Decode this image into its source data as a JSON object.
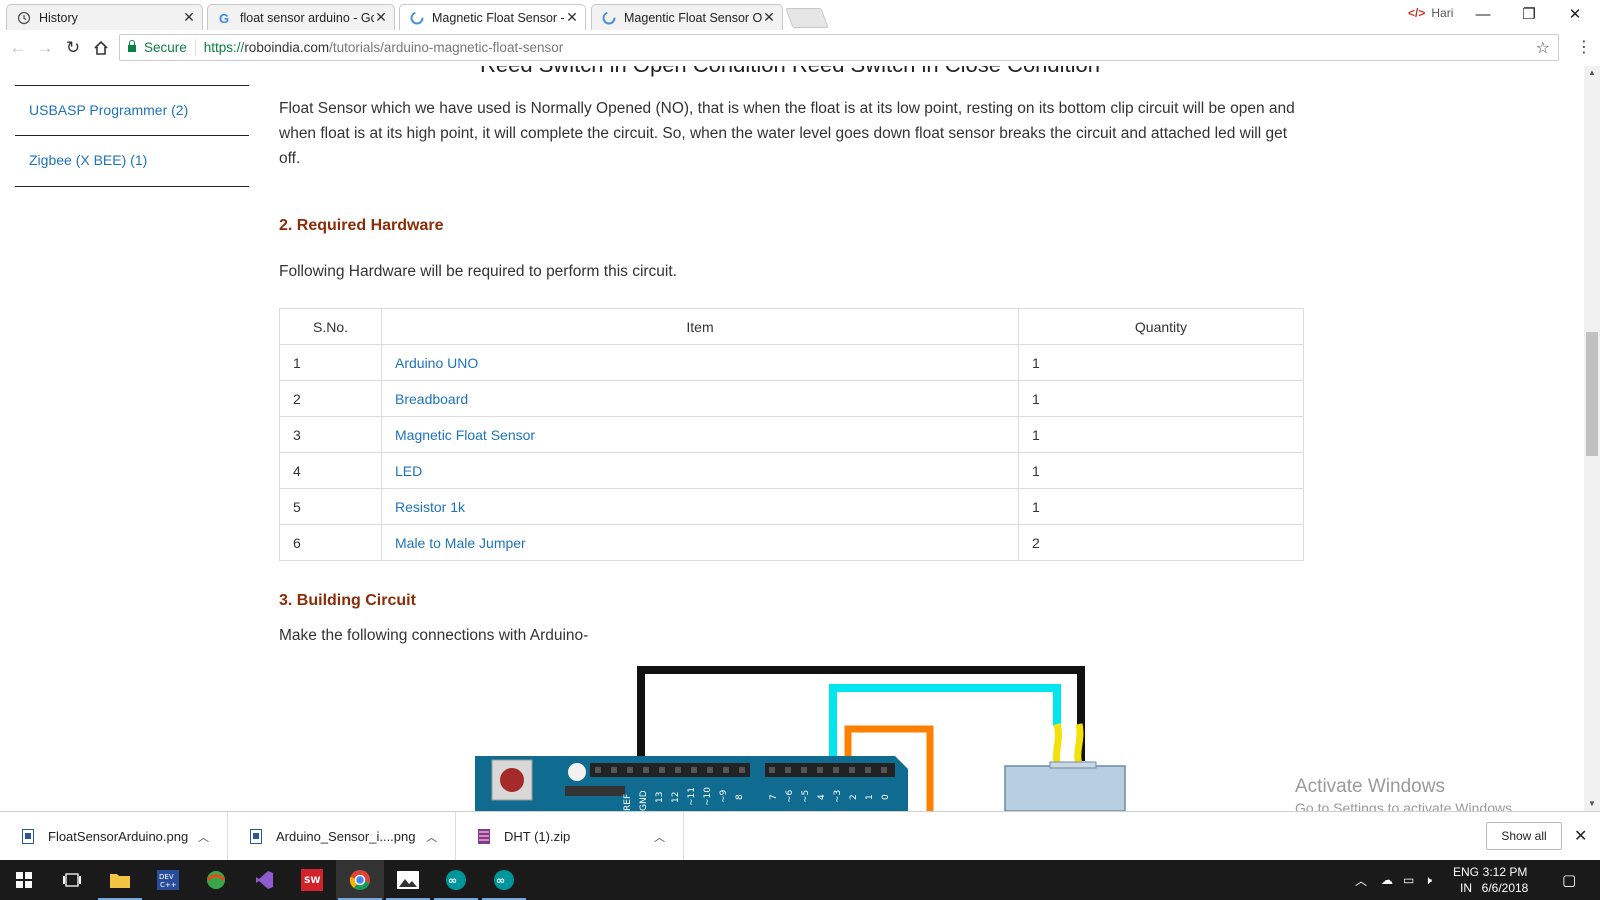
{
  "browser": {
    "tabs": [
      {
        "title": "History",
        "icon": "history-icon",
        "active": false
      },
      {
        "title": "float sensor arduino - Go",
        "icon": "google-icon",
        "active": false
      },
      {
        "title": "Magnetic Float Sensor - A",
        "icon": "loading-icon",
        "active": true
      },
      {
        "title": "Magentic Float Sensor Or",
        "icon": "loading-icon",
        "active": false
      }
    ],
    "profile_name": "Hari",
    "omnibox": {
      "secure_label": "Secure",
      "url_scheme": "https://",
      "url_host": "roboindia.com",
      "url_path": "/tutorials/arduino-magnetic-float-sensor"
    }
  },
  "page": {
    "cut_heading": "Reed Switch in Open Condition   Reed Switch in Close Condition",
    "sidebar": {
      "items": [
        {
          "label": "USBASP Programmer (2)"
        },
        {
          "label": "Zigbee (X BEE) (1)"
        }
      ]
    },
    "intro_paragraph": "Float Sensor which we have used is Normally Opened (NO), that is when the float is at its low point, resting on its bottom clip circuit will be open and when float is at its high point, it will complete the circuit. So, when the water level goes down float sensor breaks the circuit and attached led will get off.",
    "section2": {
      "heading": "2. Required Hardware",
      "text": "Following Hardware will be required to perform this circuit.",
      "table": {
        "headers": [
          "S.No.",
          "Item",
          "Quantity"
        ],
        "rows": [
          {
            "sno": "1",
            "item": "Arduino UNO",
            "qty": "1"
          },
          {
            "sno": "2",
            "item": "Breadboard",
            "qty": "1"
          },
          {
            "sno": "3",
            "item": "Magnetic Float Sensor",
            "qty": "1"
          },
          {
            "sno": "4",
            "item": "LED",
            "qty": "1"
          },
          {
            "sno": "5",
            "item": "Resistor 1k",
            "qty": "1"
          },
          {
            "sno": "6",
            "item": "Male to Male Jumper",
            "qty": "2"
          }
        ]
      }
    },
    "section3": {
      "heading": "3. Building Circuit",
      "text": "Make the following connections with Arduino-"
    },
    "circuit_pin_labels": {
      "gnd": "GND",
      "aref": "REF",
      "d13": "13",
      "d12": "12",
      "d11": "~11",
      "d10": "~10",
      "d9": "~9",
      "d8": "8",
      "d7": "7",
      "d6": "~6",
      "d5": "~5",
      "d4": "4",
      "d3": "~3",
      "d2": "2",
      "d1": "1",
      "d0": "0"
    }
  },
  "watermark": {
    "line1": "Activate Windows",
    "line2": "Go to Settings to activate Windows."
  },
  "downloads": {
    "items": [
      {
        "name": "FloatSensorArduino.png",
        "type": "image"
      },
      {
        "name": "Arduino_Sensor_i....png",
        "type": "image"
      },
      {
        "name": "DHT (1).zip",
        "type": "zip"
      }
    ],
    "show_all_label": "Show all"
  },
  "taskbar": {
    "language": "ENG",
    "region": "IN",
    "time": "3:12 PM",
    "date": "6/6/2018",
    "apps": [
      "start-icon",
      "task-view-icon",
      "file-explorer-icon",
      "dev-cpp-icon",
      "app-icon",
      "visual-studio-icon",
      "solidworks-icon",
      "chrome-icon",
      "photos-icon",
      "arduino-icon",
      "arduino-icon"
    ]
  },
  "colors": {
    "link": "#1e73be",
    "heading": "#8b2d08",
    "secure_green": "#0b8043",
    "arduino_board": "#0f6b8f",
    "wire_black": "#111111",
    "wire_cyan": "#00e5ee",
    "wire_orange": "#ff7f00",
    "wire_yellow": "#f5e10a"
  }
}
